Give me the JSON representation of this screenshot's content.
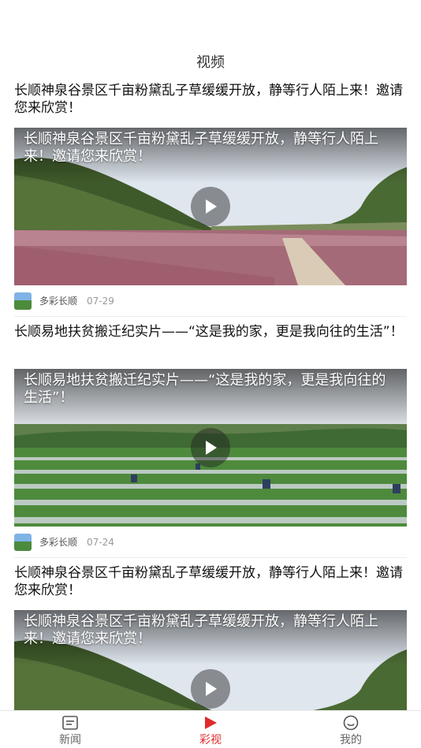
{
  "header": {
    "title": "视频"
  },
  "feed": [
    {
      "title": "长顺神泉谷景区千亩粉黛乱子草缓缓开放，静等行人陌上来！邀请您来欣赏！",
      "caption": "长顺神泉谷景区千亩粉黛乱子草缓缓开放，静等行人陌上来！邀请您来欣赏！",
      "source": "多彩长顺",
      "date": "07-29",
      "scene": "meadow"
    },
    {
      "title": "长顺易地扶贫搬迁纪实片——“这是我的家，更是我向往的生活”！",
      "caption": "长顺易地扶贫搬迁纪实片——“这是我的家，更是我向往的生活”！",
      "source": "多彩长顺",
      "date": "07-24",
      "scene": "field"
    },
    {
      "title": "长顺神泉谷景区千亩粉黛乱子草缓缓开放，静等行人陌上来！邀请您来欣赏！",
      "caption": "长顺神泉谷景区千亩粉黛乱子草缓缓开放，静等行人陌上来！邀请您来欣赏！",
      "scene": "meadow"
    }
  ],
  "tabbar": {
    "items": [
      {
        "label": "新闻",
        "icon": "news-icon",
        "active": false
      },
      {
        "label": "彩视",
        "icon": "video-play-icon",
        "active": true
      },
      {
        "label": "我的",
        "icon": "smile-icon",
        "active": false
      }
    ]
  },
  "colors": {
    "accent": "#e02b2b",
    "text": "#111111",
    "muted": "#999999"
  }
}
